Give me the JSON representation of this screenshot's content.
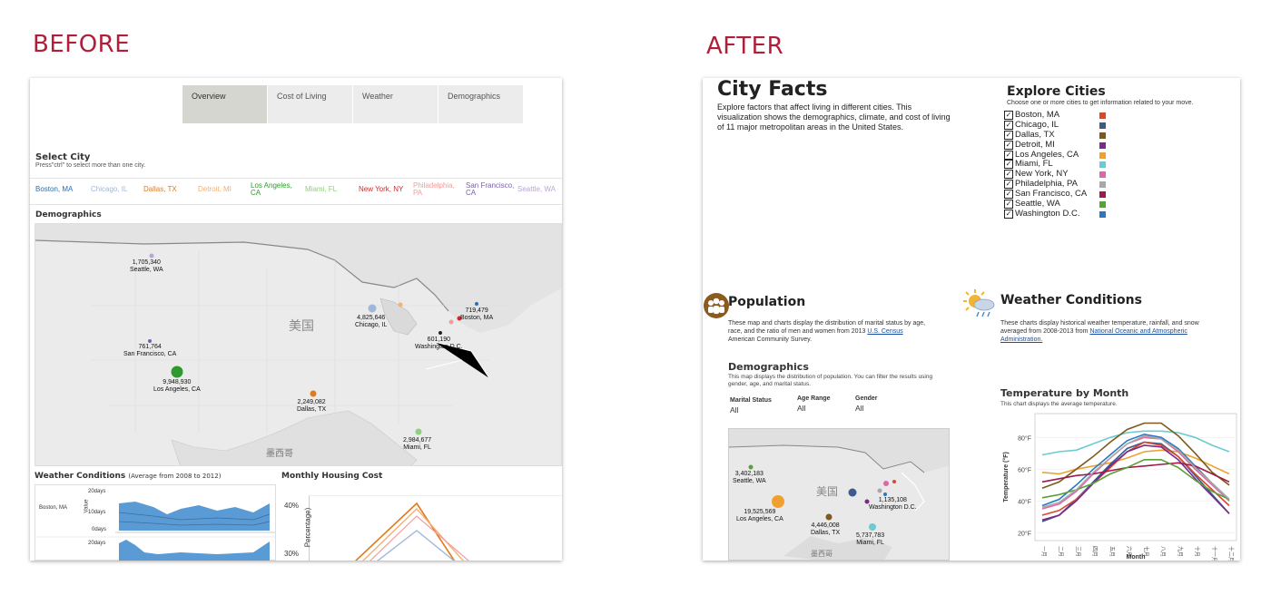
{
  "labels": {
    "before": "BEFORE",
    "after": "AFTER"
  },
  "before": {
    "tabs": [
      {
        "label": "Overview",
        "active": true
      },
      {
        "label": "Cost of Living",
        "active": false
      },
      {
        "label": "Weather",
        "active": false
      },
      {
        "label": "Demographics",
        "active": false
      }
    ],
    "select_city": {
      "title": "Select City",
      "hint": "Press\"ctrl\" to select more than one city."
    },
    "cities": [
      {
        "label": "Boston, MA",
        "color": "#2a6fb0"
      },
      {
        "label": "Chicago, IL",
        "color": "#9fb8d8"
      },
      {
        "label": "Dallas, TX",
        "color": "#e07a1a"
      },
      {
        "label": "Detroit, MI",
        "color": "#f2b074"
      },
      {
        "label": "Los Angeles, CA",
        "color": "#2e9a2e"
      },
      {
        "label": "Miami, FL",
        "color": "#8fcf7e"
      },
      {
        "label": "New York, NY",
        "color": "#d62728"
      },
      {
        "label": "Philadelphia, PA",
        "color": "#f49b9b"
      },
      {
        "label": "San Francisco, CA",
        "color": "#7b5fa8"
      },
      {
        "label": "Seattle, WA",
        "color": "#b9a6d2"
      }
    ],
    "demographics_title": "Demographics",
    "map": {
      "country_label": "美国",
      "neighbor_label": "墨西哥",
      "points": [
        {
          "value": "1,705,340",
          "city": "Seattle, WA"
        },
        {
          "value": "761,764",
          "city": "San Francisco, CA"
        },
        {
          "value": "9,948,930",
          "city": "Los Angeles, CA"
        },
        {
          "value": "2,249,082",
          "city": "Dallas, TX"
        },
        {
          "value": "4,825,646",
          "city": "Chicago, IL"
        },
        {
          "value": "719,479",
          "city": "Boston, MA"
        },
        {
          "value": "601,190",
          "city": "Washington D.C."
        },
        {
          "value": "2,984,677",
          "city": "Miami, FL"
        }
      ]
    },
    "weather": {
      "title": "Weather Conditions",
      "subtitle": "(Average from 2008 to 2012)",
      "city": "Boston, MA",
      "value_axis": "Value",
      "ticks": [
        "20days",
        "10days",
        "0days",
        "20days"
      ]
    },
    "housing": {
      "title": "Monthly Housing Cost",
      "ylabel": "Percentage)",
      "ticks": [
        "40%",
        "30%"
      ]
    }
  },
  "after": {
    "title": "City Facts",
    "description": "Explore factors that affect living in different cities. This visualization shows the demographics, climate, and cost of living of 11 major metropolitan areas in the United States.",
    "explore": {
      "title": "Explore Cities",
      "hint": "Choose one or more cities to get information related to your move.",
      "cities": [
        {
          "label": "Boston, MA",
          "color": "#d8482a"
        },
        {
          "label": "Chicago, IL",
          "color": "#3c5a8c"
        },
        {
          "label": "Dallas, TX",
          "color": "#7a5a1e"
        },
        {
          "label": "Detroit, MI",
          "color": "#7b2a8c"
        },
        {
          "label": "Los Angeles, CA",
          "color": "#f0a030"
        },
        {
          "label": "Miami, FL",
          "color": "#6ccbd2"
        },
        {
          "label": "New York, NY",
          "color": "#e066a8"
        },
        {
          "label": "Philadelphia, PA",
          "color": "#a8a8a8"
        },
        {
          "label": "San Francisco, CA",
          "color": "#a0184a"
        },
        {
          "label": "Seattle, WA",
          "color": "#5ca03a"
        },
        {
          "label": "Washington D.C.",
          "color": "#2a78c0"
        }
      ]
    },
    "population": {
      "title": "Population",
      "desc_pre": "These map and charts display the distribution of marital status by age, race, and the ratio of men and women from 2013 ",
      "desc_link": "U.S. Census",
      "desc_post": " American Community Survey."
    },
    "weather": {
      "title": "Weather Conditions",
      "desc_pre": "These charts display historical weather temperature, rainfall, and snow averaged from 2008-2013 from ",
      "desc_link": "National Oceanic and Atmospheric Administration."
    },
    "demographics": {
      "title": "Demographics",
      "desc": "This map displays the distribution of population. You can filter the results using gender, age, and marital status.",
      "filters": [
        {
          "label": "Marital Status",
          "value": "All"
        },
        {
          "label": "Age Range",
          "value": "All"
        },
        {
          "label": "Gender",
          "value": "All"
        }
      ]
    },
    "map": {
      "country_label": "美国",
      "neighbor_label": "墨西哥",
      "points": [
        {
          "value": "3,402,183",
          "city": "Seattle, WA"
        },
        {
          "value": "19,525,569",
          "city": "Los Angeles, CA"
        },
        {
          "value": "4,446,008",
          "city": "Dallas, TX"
        },
        {
          "value": "1,135,108",
          "city": "Washington D.C."
        },
        {
          "value": "5,737,783",
          "city": "Miami, FL"
        }
      ]
    },
    "temperature": {
      "title": "Temperature by Month",
      "subtitle": "This chart displays the average temperature."
    }
  },
  "chart_data": {
    "type": "line",
    "title": "Temperature by Month",
    "xlabel": "Month",
    "ylabel": "Temperature (°F)",
    "x": [
      "一月",
      "二月",
      "三月",
      "四月",
      "五月",
      "六月",
      "七月",
      "八月",
      "九月",
      "十月",
      "十一月",
      "十二月"
    ],
    "y_ticks": [
      "20°F",
      "40°F",
      "60°F",
      "80°F"
    ],
    "ylim": [
      15,
      95
    ],
    "series": [
      {
        "color": "#6ccbd2",
        "values": [
          69,
          71,
          72,
          76,
          80,
          83,
          84,
          84,
          83,
          80,
          75,
          71
        ]
      },
      {
        "color": "#f0a030",
        "values": [
          58,
          57,
          60,
          62,
          64,
          67,
          71,
          72,
          71,
          67,
          62,
          57
        ]
      },
      {
        "color": "#7a5a1e",
        "values": [
          48,
          52,
          60,
          68,
          77,
          85,
          89,
          89,
          81,
          70,
          58,
          50
        ]
      },
      {
        "color": "#2a78c0",
        "values": [
          37,
          41,
          50,
          60,
          69,
          78,
          82,
          80,
          73,
          62,
          51,
          41
        ]
      },
      {
        "color": "#e066a8",
        "values": [
          35,
          38,
          46,
          57,
          67,
          76,
          80,
          79,
          71,
          60,
          50,
          40
        ]
      },
      {
        "color": "#3c5a8c",
        "values": [
          27,
          31,
          41,
          52,
          63,
          73,
          77,
          76,
          68,
          56,
          44,
          32
        ]
      },
      {
        "color": "#d8482a",
        "values": [
          31,
          34,
          41,
          51,
          61,
          71,
          77,
          75,
          68,
          57,
          47,
          37
        ]
      },
      {
        "color": "#7b2a8c",
        "values": [
          28,
          31,
          40,
          51,
          62,
          71,
          75,
          74,
          66,
          54,
          43,
          32
        ]
      },
      {
        "color": "#a0184a",
        "values": [
          52,
          54,
          56,
          57,
          59,
          61,
          62,
          63,
          64,
          62,
          57,
          52
        ]
      },
      {
        "color": "#5ca03a",
        "values": [
          42,
          44,
          47,
          51,
          57,
          61,
          66,
          66,
          61,
          53,
          46,
          41
        ]
      },
      {
        "color": "#a8a8a8",
        "values": [
          36,
          39,
          47,
          58,
          67,
          76,
          81,
          79,
          72,
          61,
          51,
          41
        ]
      }
    ]
  }
}
